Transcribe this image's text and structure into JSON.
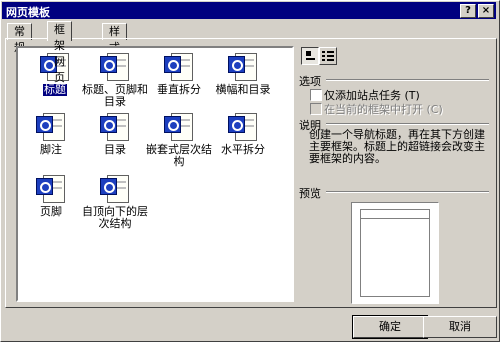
{
  "window": {
    "title": "网页模板",
    "help_label": "?",
    "close_label": "×"
  },
  "tabs": [
    {
      "label": "常规"
    },
    {
      "label": "框架网页"
    },
    {
      "label": "样式表"
    }
  ],
  "templates": [
    {
      "label": "标题",
      "selected": true
    },
    {
      "label": "标题、页脚和目录"
    },
    {
      "label": "垂直拆分"
    },
    {
      "label": "横幅和目录"
    },
    {
      "label": "脚注"
    },
    {
      "label": "目录"
    },
    {
      "label": "嵌套式层次结构"
    },
    {
      "label": "水平拆分"
    },
    {
      "label": "页脚"
    },
    {
      "label": "自顶向下的层次结构"
    }
  ],
  "view_buttons": {
    "large_icons": "large-icons-view-icon",
    "details": "details-view-icon"
  },
  "options": {
    "title": "选项",
    "add_task": "仅添加站点任务 (T)",
    "open_in_current": "在当前的框架中打开 (C)"
  },
  "description": {
    "title": "说明",
    "text": "创建一个导航标题，再在其下方创建主要框架。标题上的超链接会改变主要框架的内容。"
  },
  "preview": {
    "title": "预览"
  },
  "buttons": {
    "ok": "确定",
    "cancel": "取消"
  }
}
